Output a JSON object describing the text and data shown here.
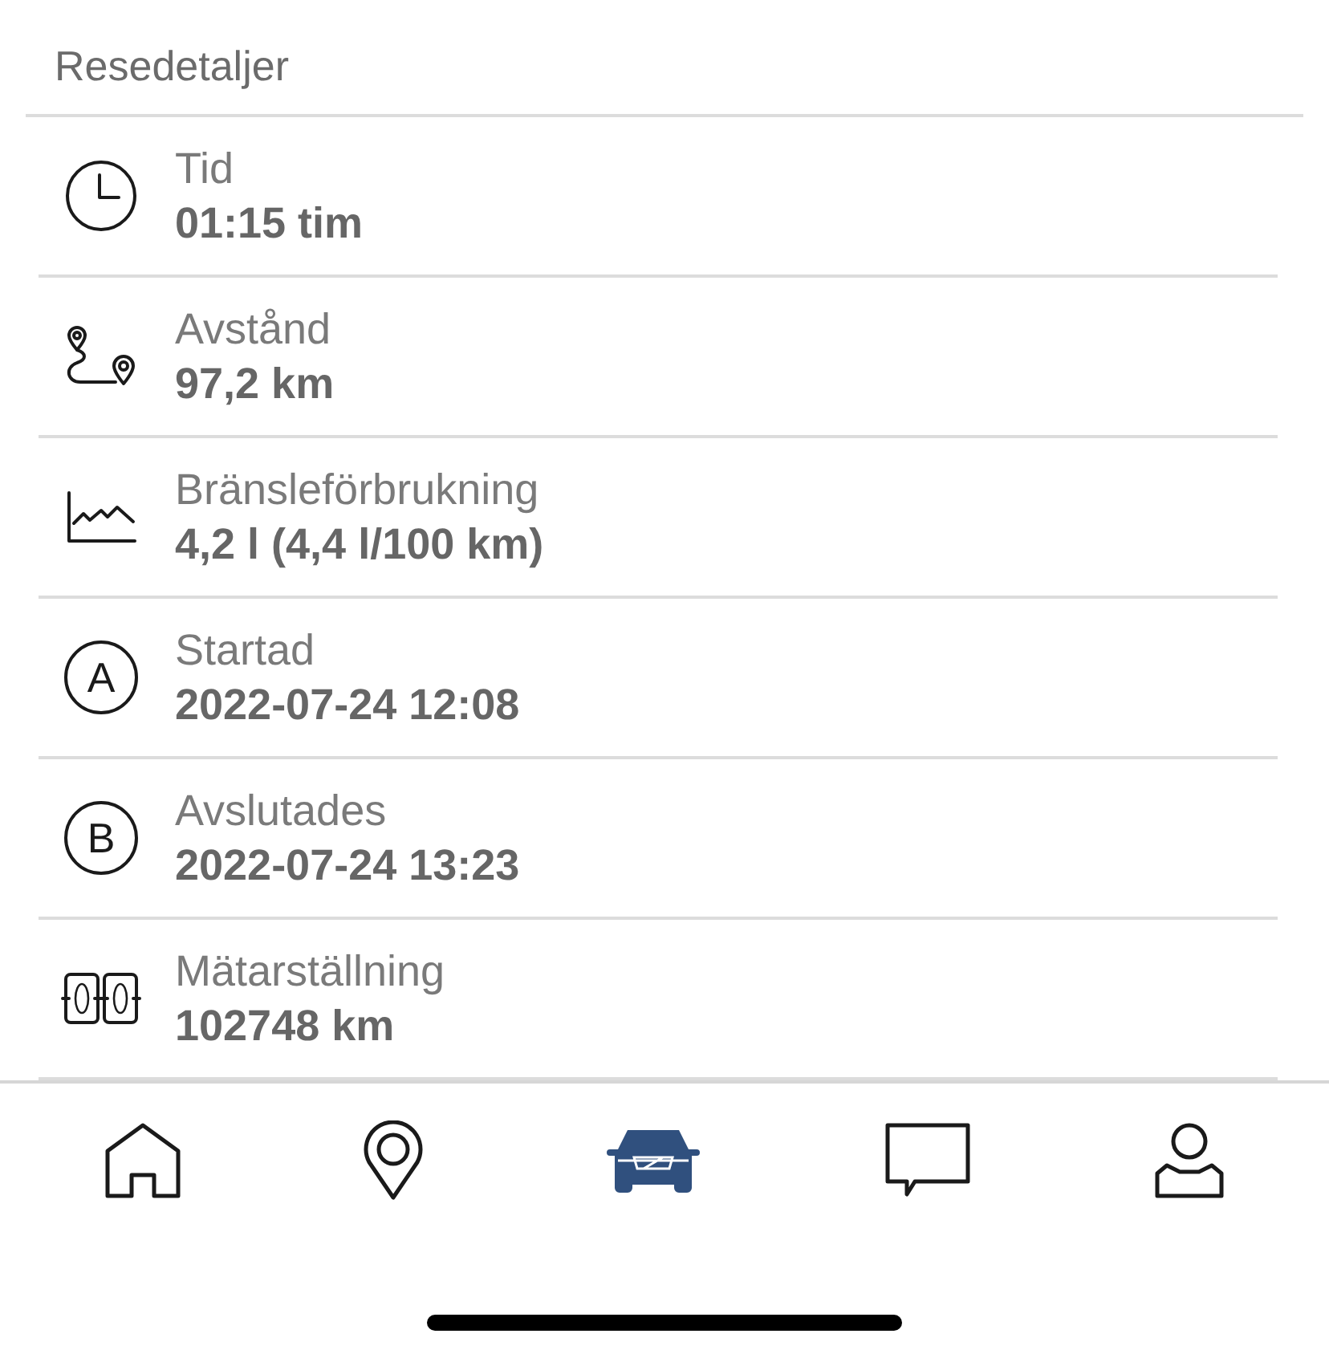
{
  "header": {
    "title": "Resedetaljer"
  },
  "details": [
    {
      "kind": "clock",
      "label": "Tid",
      "value": "01:15 tim"
    },
    {
      "kind": "route",
      "label": "Avstånd",
      "value": "97,2 km"
    },
    {
      "kind": "chart",
      "label": "Bränsleförbrukning",
      "value": "4,2 l (4,4 l/100 km)"
    },
    {
      "kind": "letter",
      "badge": "A",
      "label": "Startad",
      "value": "2022-07-24 12:08"
    },
    {
      "kind": "letter",
      "badge": "B",
      "label": "Avslutades",
      "value": "2022-07-24 13:23"
    },
    {
      "kind": "odometer",
      "label": "Mätarställning",
      "value": "102748 km"
    }
  ],
  "tab_bar": [
    {
      "kind": "home",
      "selected": false
    },
    {
      "kind": "map",
      "selected": false
    },
    {
      "kind": "car",
      "selected": true
    },
    {
      "kind": "chat",
      "selected": false
    },
    {
      "kind": "profile",
      "selected": false
    }
  ]
}
